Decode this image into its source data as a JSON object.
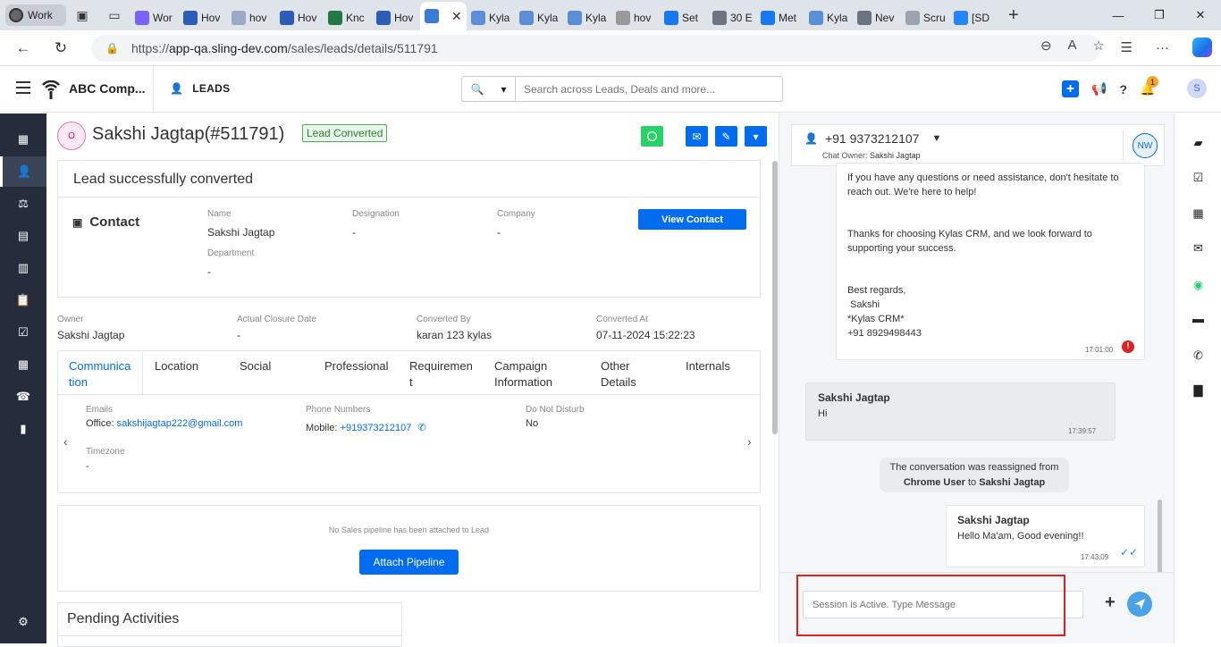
{
  "browser": {
    "profile_label": "Work",
    "tabs": [
      {
        "label": "Wor",
        "color": "#7b61ff"
      },
      {
        "label": "Hov",
        "color": "#2b5cb8"
      },
      {
        "label": "hov",
        "color": "#9aa9c4"
      },
      {
        "label": "Hov",
        "color": "#2b5cb8"
      },
      {
        "label": "Knc",
        "color": "#1f7a44"
      },
      {
        "label": "Hov",
        "color": "#2b5cb8"
      },
      {
        "label": "",
        "color": "#3a7bd5"
      },
      {
        "label": "Kyla",
        "color": "#5c8ed8"
      },
      {
        "label": "Kyla",
        "color": "#5c8ed8"
      },
      {
        "label": "Kyla",
        "color": "#5c8ed8"
      },
      {
        "label": "hov",
        "color": "#999999"
      },
      {
        "label": "Set",
        "color": "#1877f2"
      },
      {
        "label": "30 E",
        "color": "#6b7280"
      },
      {
        "label": "Met",
        "color": "#1877f2"
      },
      {
        "label": "Kyla",
        "color": "#5c8ed8"
      },
      {
        "label": "Nev",
        "color": "#6b7280"
      },
      {
        "label": "Scru",
        "color": "#9ca3af"
      },
      {
        "label": "[SD",
        "color": "#2684ff"
      }
    ],
    "url_prefix": "https://",
    "url_host": "app-qa.sling-dev.com",
    "url_path": "/sales/leads/details/511791"
  },
  "header": {
    "company": "ABC Comp...",
    "module": "LEADS",
    "search_placeholder": "Search across Leads, Deals and more...",
    "notification_count": "1",
    "user_initial": "S"
  },
  "lead": {
    "avatar_initial": "O",
    "name": "Sakshi Jagtap(#511791)",
    "status_badge": "Lead Converted",
    "converted_title": "Lead successfully converted",
    "contact": {
      "section_label": "Contact",
      "name_label": "Name",
      "name": "Sakshi Jagtap",
      "designation_label": "Designation",
      "designation": "-",
      "company_label": "Company",
      "company": "-",
      "department_label": "Department",
      "department": "-",
      "view_button": "View Contact"
    },
    "summary": {
      "owner_label": "Owner",
      "owner": "Sakshi Jagtap",
      "closure_label": "Actual Closure Date",
      "closure": "-",
      "converted_by_label": "Converted By",
      "converted_by": "karan 123 kylas",
      "converted_at_label": "Converted At",
      "converted_at": "07-11-2024 15:22:23"
    },
    "detail_tabs": {
      "communication_l1": "Communica",
      "communication_l2": "tion",
      "location": "Location",
      "social": "Social",
      "professional": "Professional",
      "requirement_l1": "Requiremen",
      "requirement_l2": "t",
      "campaign_l1": "Campaign",
      "campaign_l2": "Information",
      "other_l1": "Other",
      "other_l2": "Details",
      "internals": "Internals"
    },
    "communication": {
      "emails_label": "Emails",
      "email_prefix": "Office:",
      "email": "sakshijagtap222@gmail.com",
      "phones_label": "Phone Numbers",
      "phone_prefix": "Mobile:",
      "phone": "+919373212107",
      "dnd_label": "Do Not Disturb",
      "dnd": "No",
      "timezone_label": "Timezone",
      "timezone": "-"
    },
    "pipeline": {
      "empty_text": "No Sales pipeline has been attached to Lead",
      "attach_button": "Attach Pipeline"
    },
    "pending_title": "Pending Activities"
  },
  "chat": {
    "phone": "+91 9373212107",
    "owner_label": "Chat Owner:",
    "owner": "Sakshi Jagtap",
    "owner_initials": "NW",
    "msg1": {
      "l1": "If you have any questions or need assistance, don't hesitate to",
      "l2": "reach out. We're here to help!",
      "l3": "Thanks for choosing Kylas CRM, and we look forward to",
      "l4": "supporting your success.",
      "l5": "Best regards,",
      "l6": " Sakshi",
      "l7": "*Kylas CRM*",
      "l8": "+91 8929498443",
      "time": "17:01:00"
    },
    "msg2": {
      "sender": "Sakshi Jagtap",
      "text": "Hi",
      "time": "17:39:57"
    },
    "system": {
      "prefix": "The conversation was reassigned from",
      "from": "Chrome User",
      "to_word": "to",
      "to": "Sakshi Jagtap"
    },
    "msg3": {
      "sender": "Sakshi Jagtap",
      "text": "Hello Ma'am, Good evening!!",
      "time": "17:43:09"
    },
    "input_placeholder": "Session is Active. Type Message"
  }
}
